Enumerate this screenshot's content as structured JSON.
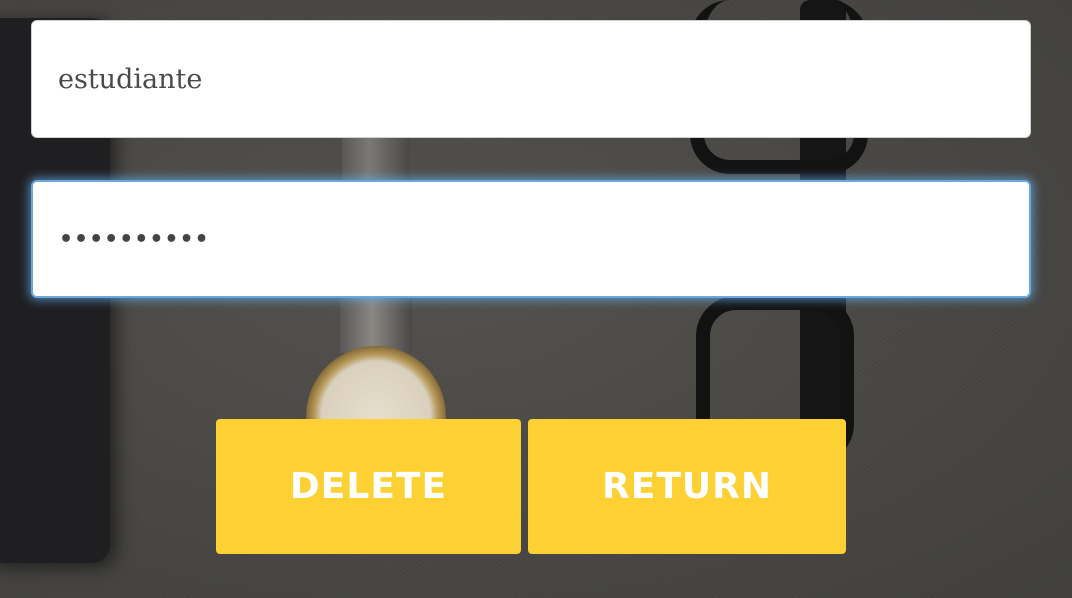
{
  "form": {
    "username_value": "estudiante",
    "password_masked": "••••••••••"
  },
  "buttons": {
    "delete_label": "DELETE",
    "return_label": "RETURN"
  },
  "colors": {
    "button_bg": "#fdd033",
    "button_text": "#ffffff",
    "focus_glow": "#66afe9"
  }
}
